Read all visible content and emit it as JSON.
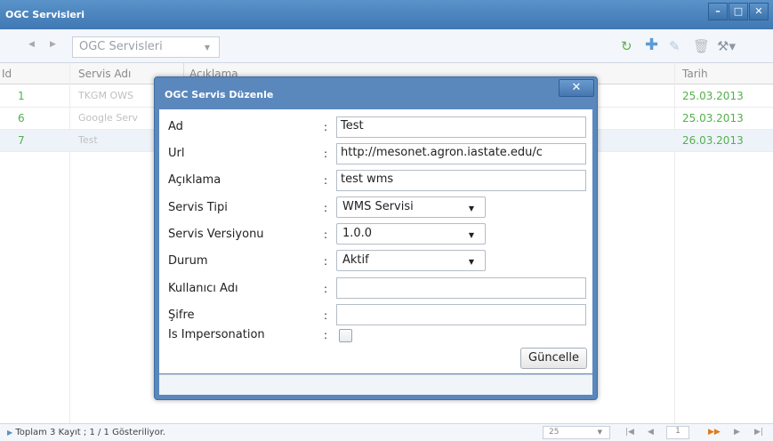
{
  "window": {
    "title": "OGC Servisleri",
    "controls": [
      "minimize-icon",
      "maximize-icon",
      "close-icon"
    ]
  },
  "toolbar": {
    "combo_value": "OGC Servisleri",
    "icons": [
      "refresh-icon",
      "add-icon",
      "edit-icon",
      "delete-icon",
      "tools-icon"
    ]
  },
  "grid": {
    "columns": [
      "Id",
      "Servis Adı",
      "Açıklama",
      "Tarih"
    ],
    "rows": [
      {
        "id": "1",
        "name": "TKGM OWS",
        "date": "25.03.2013"
      },
      {
        "id": "6",
        "name": "Google Serv",
        "date": "25.03.2013"
      },
      {
        "id": "7",
        "name": "Test",
        "date": "26.03.2013"
      }
    ]
  },
  "status": {
    "summary": "Toplam 3 Kayıt ; 1 / 1 Gösteriliyor.",
    "page_size": "25",
    "page_number": "1"
  },
  "dialog": {
    "title": "OGC Servis Düzenle",
    "close_symbol": "✕",
    "separator": ":",
    "labels": {
      "ad": "Ad",
      "url": "Url",
      "aciklama": "Açıklama",
      "servis_tipi": "Servis Tipi",
      "servis_versiyonu": "Servis Versiyonu",
      "durum": "Durum",
      "kullanici_adi": "Kullanıcı Adı",
      "sifre": "Şifre",
      "impersonation": "Is Impersonation"
    },
    "values": {
      "ad": "Test",
      "url": "http://mesonet.agron.iastate.edu/c",
      "aciklama": "test wms",
      "servis_tipi": "WMS Servisi",
      "servis_versiyonu": "1.0.0",
      "durum": "Aktif",
      "kullanici_adi": "",
      "sifre": ""
    },
    "impersonation_checked": false,
    "submit_label": "Güncelle"
  }
}
